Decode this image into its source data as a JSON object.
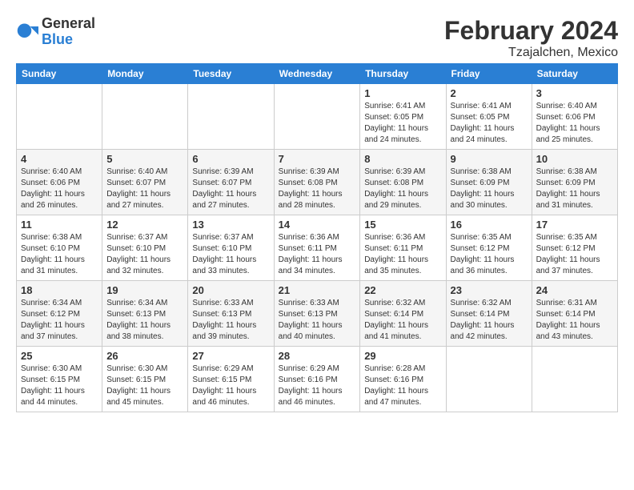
{
  "header": {
    "logo_general": "General",
    "logo_blue": "Blue",
    "month_year": "February 2024",
    "location": "Tzajalchen, Mexico"
  },
  "weekdays": [
    "Sunday",
    "Monday",
    "Tuesday",
    "Wednesday",
    "Thursday",
    "Friday",
    "Saturday"
  ],
  "weeks": [
    [
      {
        "day": "",
        "info": ""
      },
      {
        "day": "",
        "info": ""
      },
      {
        "day": "",
        "info": ""
      },
      {
        "day": "",
        "info": ""
      },
      {
        "day": "1",
        "info": "Sunrise: 6:41 AM\nSunset: 6:05 PM\nDaylight: 11 hours and 24 minutes."
      },
      {
        "day": "2",
        "info": "Sunrise: 6:41 AM\nSunset: 6:05 PM\nDaylight: 11 hours and 24 minutes."
      },
      {
        "day": "3",
        "info": "Sunrise: 6:40 AM\nSunset: 6:06 PM\nDaylight: 11 hours and 25 minutes."
      }
    ],
    [
      {
        "day": "4",
        "info": "Sunrise: 6:40 AM\nSunset: 6:06 PM\nDaylight: 11 hours and 26 minutes."
      },
      {
        "day": "5",
        "info": "Sunrise: 6:40 AM\nSunset: 6:07 PM\nDaylight: 11 hours and 27 minutes."
      },
      {
        "day": "6",
        "info": "Sunrise: 6:39 AM\nSunset: 6:07 PM\nDaylight: 11 hours and 27 minutes."
      },
      {
        "day": "7",
        "info": "Sunrise: 6:39 AM\nSunset: 6:08 PM\nDaylight: 11 hours and 28 minutes."
      },
      {
        "day": "8",
        "info": "Sunrise: 6:39 AM\nSunset: 6:08 PM\nDaylight: 11 hours and 29 minutes."
      },
      {
        "day": "9",
        "info": "Sunrise: 6:38 AM\nSunset: 6:09 PM\nDaylight: 11 hours and 30 minutes."
      },
      {
        "day": "10",
        "info": "Sunrise: 6:38 AM\nSunset: 6:09 PM\nDaylight: 11 hours and 31 minutes."
      }
    ],
    [
      {
        "day": "11",
        "info": "Sunrise: 6:38 AM\nSunset: 6:10 PM\nDaylight: 11 hours and 31 minutes."
      },
      {
        "day": "12",
        "info": "Sunrise: 6:37 AM\nSunset: 6:10 PM\nDaylight: 11 hours and 32 minutes."
      },
      {
        "day": "13",
        "info": "Sunrise: 6:37 AM\nSunset: 6:10 PM\nDaylight: 11 hours and 33 minutes."
      },
      {
        "day": "14",
        "info": "Sunrise: 6:36 AM\nSunset: 6:11 PM\nDaylight: 11 hours and 34 minutes."
      },
      {
        "day": "15",
        "info": "Sunrise: 6:36 AM\nSunset: 6:11 PM\nDaylight: 11 hours and 35 minutes."
      },
      {
        "day": "16",
        "info": "Sunrise: 6:35 AM\nSunset: 6:12 PM\nDaylight: 11 hours and 36 minutes."
      },
      {
        "day": "17",
        "info": "Sunrise: 6:35 AM\nSunset: 6:12 PM\nDaylight: 11 hours and 37 minutes."
      }
    ],
    [
      {
        "day": "18",
        "info": "Sunrise: 6:34 AM\nSunset: 6:12 PM\nDaylight: 11 hours and 37 minutes."
      },
      {
        "day": "19",
        "info": "Sunrise: 6:34 AM\nSunset: 6:13 PM\nDaylight: 11 hours and 38 minutes."
      },
      {
        "day": "20",
        "info": "Sunrise: 6:33 AM\nSunset: 6:13 PM\nDaylight: 11 hours and 39 minutes."
      },
      {
        "day": "21",
        "info": "Sunrise: 6:33 AM\nSunset: 6:13 PM\nDaylight: 11 hours and 40 minutes."
      },
      {
        "day": "22",
        "info": "Sunrise: 6:32 AM\nSunset: 6:14 PM\nDaylight: 11 hours and 41 minutes."
      },
      {
        "day": "23",
        "info": "Sunrise: 6:32 AM\nSunset: 6:14 PM\nDaylight: 11 hours and 42 minutes."
      },
      {
        "day": "24",
        "info": "Sunrise: 6:31 AM\nSunset: 6:14 PM\nDaylight: 11 hours and 43 minutes."
      }
    ],
    [
      {
        "day": "25",
        "info": "Sunrise: 6:30 AM\nSunset: 6:15 PM\nDaylight: 11 hours and 44 minutes."
      },
      {
        "day": "26",
        "info": "Sunrise: 6:30 AM\nSunset: 6:15 PM\nDaylight: 11 hours and 45 minutes."
      },
      {
        "day": "27",
        "info": "Sunrise: 6:29 AM\nSunset: 6:15 PM\nDaylight: 11 hours and 46 minutes."
      },
      {
        "day": "28",
        "info": "Sunrise: 6:29 AM\nSunset: 6:16 PM\nDaylight: 11 hours and 46 minutes."
      },
      {
        "day": "29",
        "info": "Sunrise: 6:28 AM\nSunset: 6:16 PM\nDaylight: 11 hours and 47 minutes."
      },
      {
        "day": "",
        "info": ""
      },
      {
        "day": "",
        "info": ""
      }
    ]
  ]
}
